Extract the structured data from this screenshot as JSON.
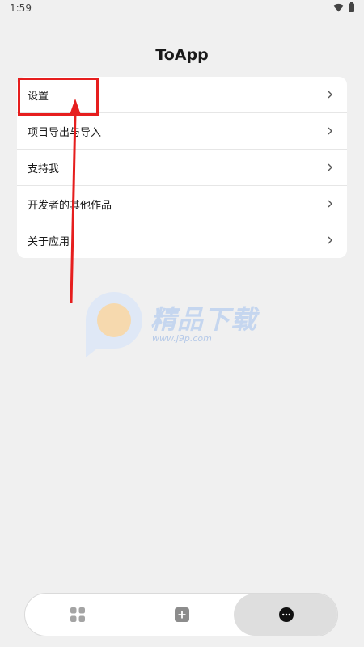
{
  "status_bar": {
    "time": "1:59",
    "icons": [
      "wifi-icon",
      "battery-icon"
    ]
  },
  "header": {
    "title": "ToApp"
  },
  "menu": {
    "items": [
      {
        "label": "设置",
        "icon": "chevron-right-icon"
      },
      {
        "label": "项目导出与导入",
        "icon": "chevron-right-icon"
      },
      {
        "label": "支持我",
        "icon": "chevron-right-icon"
      },
      {
        "label": "开发者的其他作品",
        "icon": "chevron-right-icon"
      },
      {
        "label": "关于应用",
        "icon": "chevron-right-icon"
      }
    ]
  },
  "watermark": {
    "text": "精品下载",
    "url": "www.j9p.com"
  },
  "bottom_nav": {
    "tabs": [
      {
        "name": "home",
        "icon": "grid-icon",
        "selected": false
      },
      {
        "name": "create",
        "icon": "plus-square-icon",
        "selected": false
      },
      {
        "name": "more",
        "icon": "more-dots-icon",
        "selected": true
      }
    ]
  },
  "colors": {
    "background": "#f0f0f0",
    "card": "#ffffff",
    "highlight": "#e61e1e",
    "selected_tab": "#dedede"
  }
}
